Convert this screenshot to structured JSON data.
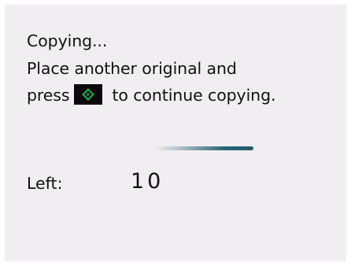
{
  "screen": {
    "status": "Copying...",
    "instruction_line1": "Place another original and",
    "instruction_line2_before": "press",
    "instruction_line2_after": "to continue copying.",
    "start_icon": "start-button-icon",
    "progress_fraction": 0.5,
    "left_label": "Left:",
    "left_value": "10",
    "colors": {
      "background": "#f1eef1",
      "text": "#111111",
      "progress": "#2a6776",
      "start_icon_bg": "#0a0a0a",
      "start_icon_accent": "#1fa84a"
    }
  }
}
